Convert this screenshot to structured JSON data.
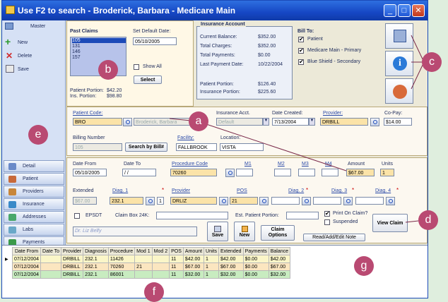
{
  "window": {
    "title": "Use F2 to search - Broderick, Barbara - Medicare Main",
    "controls": {
      "minimize": "_",
      "maximize": "□",
      "close": "✕"
    }
  },
  "sidebar": {
    "master_label": "Master",
    "actions": [
      "New",
      "Delete",
      "Save"
    ],
    "nav_items": [
      "Detail",
      "Patient",
      "Providers",
      "Insurance",
      "Addresses",
      "Labs",
      "Payments"
    ]
  },
  "past_claims": {
    "title": "Past Claims",
    "claims": [
      "105",
      "131",
      "146",
      "157"
    ],
    "set_default_date_label": "Set Default Date:",
    "default_date": "05/10/2005",
    "show_all_label": "Show All",
    "select_label": "Select",
    "patient_portion_label": "Patient Portion:",
    "patient_portion_value": "$42.20",
    "ins_portion_label": "Ins. Portion:",
    "ins_portion_value": "$98.80"
  },
  "insurance_account": {
    "title": "Insurance Account",
    "rows": [
      {
        "label": "Current Balance:",
        "value": "$352.00"
      },
      {
        "label": "Total Charges:",
        "value": "$352.00"
      },
      {
        "label": "Total Payments:",
        "value": "$0.00"
      },
      {
        "label": "Last Payment Date:",
        "value": "10/22/2004"
      }
    ],
    "patient_portion_label": "Patient Portion:",
    "patient_portion_value": "$126.40",
    "insurance_portion_label": "Insurance Portion:",
    "insurance_portion_value": "$225.60"
  },
  "bill_to": {
    "title": "Bill To:",
    "options": [
      {
        "label": "Patient",
        "checked": true
      },
      {
        "label": "Medicare Main - Primary",
        "checked": true
      },
      {
        "label": "Blue Shield - Secondary",
        "checked": true
      }
    ]
  },
  "patient_section": {
    "patient_code_label": "Patient Code:",
    "patient_code_value": "BRO",
    "patient_name_value": "Broderick, Barbara",
    "insurance_acct_label": "Insurance Acct.",
    "insurance_acct_value": "Default",
    "date_created_label": "Date Created:",
    "date_created_value": "7/13/2004",
    "provider_label": "Provider:",
    "provider_value": "DRBILL",
    "copay_label": "Co-Pay:",
    "copay_value": "$14.00",
    "billing_number_label": "Billing Number",
    "billing_number_value": "105",
    "search_by_bill_label": "Search by Bill#",
    "facility_label": "Facility:",
    "facility_value": "FALLBROOK",
    "location_label": "Location:",
    "location_value": "VISTA"
  },
  "procedure_section": {
    "date_from_label": "Date From",
    "date_from_value": "05/10/2005",
    "date_to_label": "Date To",
    "date_to_value": "/ /",
    "procedure_code_label": "Procedure Code",
    "procedure_code_value": "70260",
    "m1_label": "M1",
    "m2_label": "M2",
    "m3_label": "M3",
    "m4_label": "M4",
    "amount_label": "Amount",
    "amount_value": "$67.00",
    "units_label": "Units",
    "units_value": "1",
    "extended_label": "Extended",
    "extended_value": "$67.00",
    "diag1_label": "Diag. 1",
    "diag1_value": "232.1",
    "diag1_index": "1",
    "provider_label": "Provider",
    "provider_value": "DRLIZ",
    "pos_label": "POS",
    "pos_value": "21",
    "diag2_label": "Diag. 2",
    "diag3_label": "Diag. 3",
    "diag4_label": "Diag. 4",
    "epsdt_label": "EPSDT",
    "claim_box_label": "Claim Box 24K:",
    "est_patient_portion_label": "Est. Patient Portion:",
    "print_on_claim_label": "Print On Claim?",
    "suspended_label": "Suspended",
    "provider_name": "Dr. Liz Belfy",
    "save_label": "Save",
    "new_label": "New",
    "claim_options_label": "Claim Options",
    "note_label": "Read/Add/Edit Note",
    "view_claim_label": "View Claim"
  },
  "grid": {
    "columns": [
      "Date From",
      "Date To",
      "Provider",
      "Diagnosis",
      "Procedure",
      "Mod 1",
      "Mod 2",
      "POS",
      "Amount",
      "Units",
      "Extended",
      "Payments",
      "Balance"
    ],
    "rows": [
      {
        "date_from": "07/12/2004",
        "date_to": "",
        "provider": "DRBILL",
        "diagnosis": "232.1",
        "procedure": "11426",
        "mod1": "",
        "mod2": "",
        "pos": "11",
        "amount": "$42.00",
        "units": "1",
        "extended": "$42.00",
        "payments": "$0.00",
        "balance": "$42.00",
        "color": "#fbf6c8"
      },
      {
        "date_from": "07/12/2004",
        "date_to": "",
        "provider": "DRBILL",
        "diagnosis": "232.1",
        "procedure": "70260",
        "mod1": "21",
        "mod2": "",
        "pos": "11",
        "amount": "$67.00",
        "units": "1",
        "extended": "$67.00",
        "payments": "$0.00",
        "balance": "$67.00",
        "color": "#fbe6c0"
      },
      {
        "date_from": "07/12/2004",
        "date_to": "",
        "provider": "DRBILL",
        "diagnosis": "232.1",
        "procedure": "86001",
        "mod1": "",
        "mod2": "",
        "pos": "11",
        "amount": "$32.00",
        "units": "1",
        "extended": "$32.00",
        "payments": "$0.00",
        "balance": "$32.00",
        "color": "#c8ecc0"
      }
    ]
  },
  "callouts": [
    "a",
    "b",
    "c",
    "d",
    "e",
    "f",
    "g"
  ],
  "colors": {
    "callout": "#b94a72",
    "titlebar": "#1647c4",
    "highlight_field": "#fbe3a8"
  }
}
